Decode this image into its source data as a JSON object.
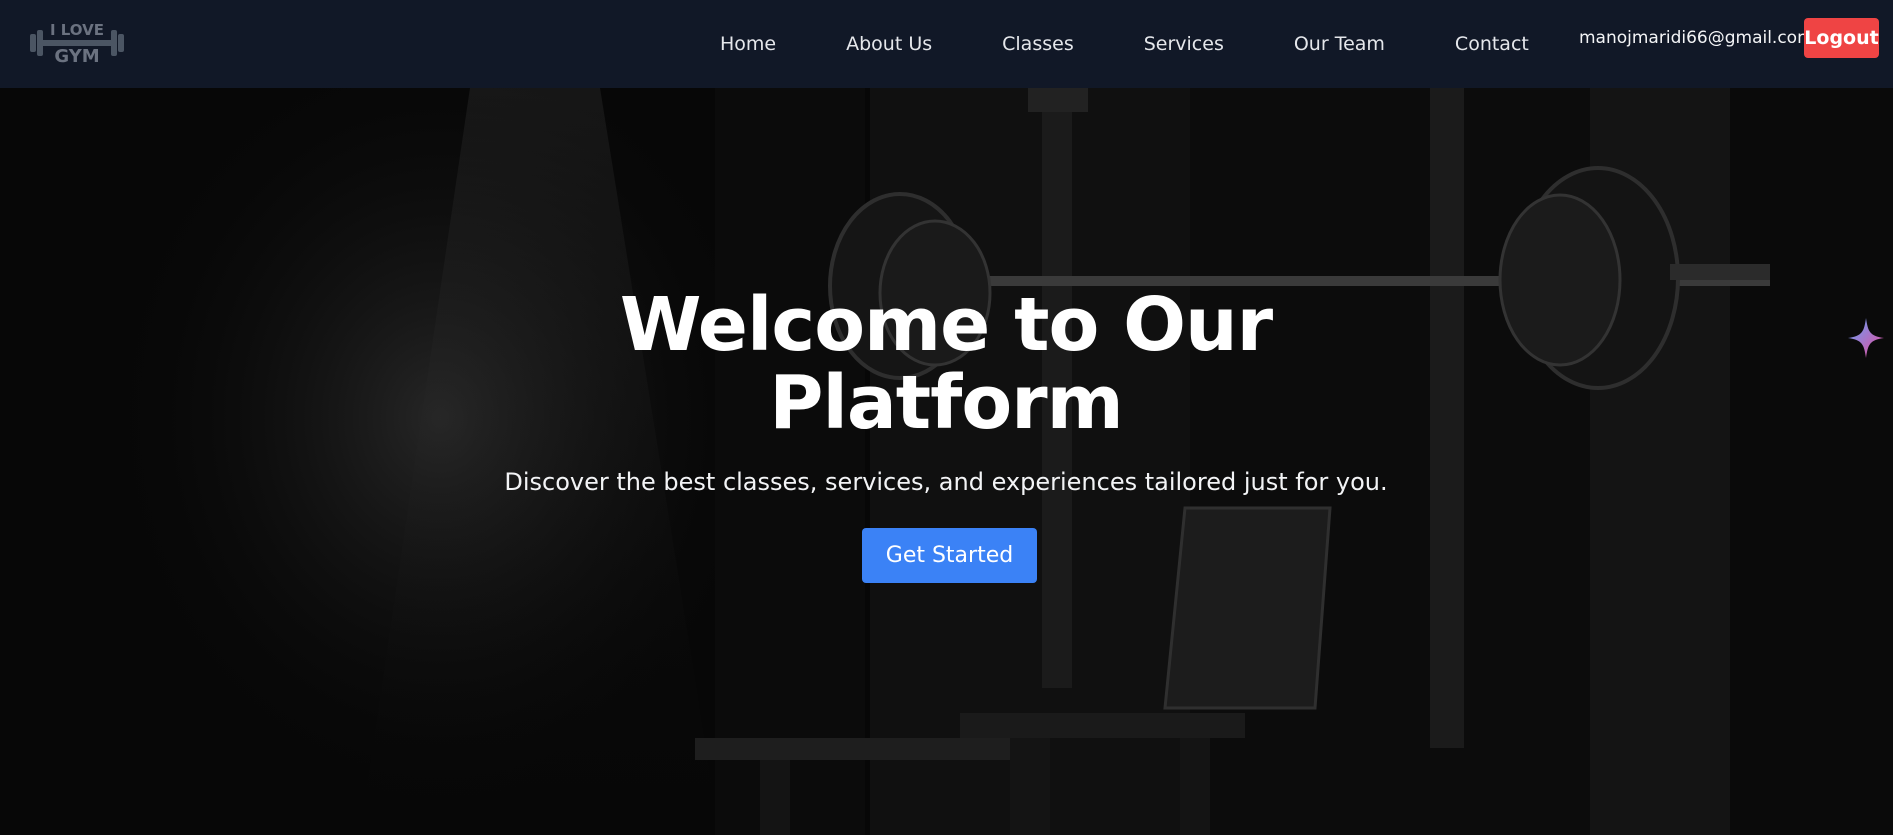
{
  "brand": {
    "logo_text_top": "I LOVE",
    "logo_text_bottom": "GYM"
  },
  "nav": {
    "links": [
      "Home",
      "About Us",
      "Classes",
      "Services",
      "Our Team",
      "Contact"
    ]
  },
  "user": {
    "email": "manojmaridi66@gmail.com",
    "logout_label": "Logout"
  },
  "hero": {
    "title_line1": "Welcome to Our",
    "title_line2": "Platform",
    "subtitle": "Discover the best classes, services, and experiences tailored just for you.",
    "cta_label": "Get Started"
  },
  "colors": {
    "navbar_bg": "#111827",
    "logout_bg": "#ef4444",
    "cta_bg": "#3b82f6",
    "hero_text": "#ffffff"
  },
  "icons": [
    "dumbbell-logo-icon",
    "sparkle-icon"
  ]
}
